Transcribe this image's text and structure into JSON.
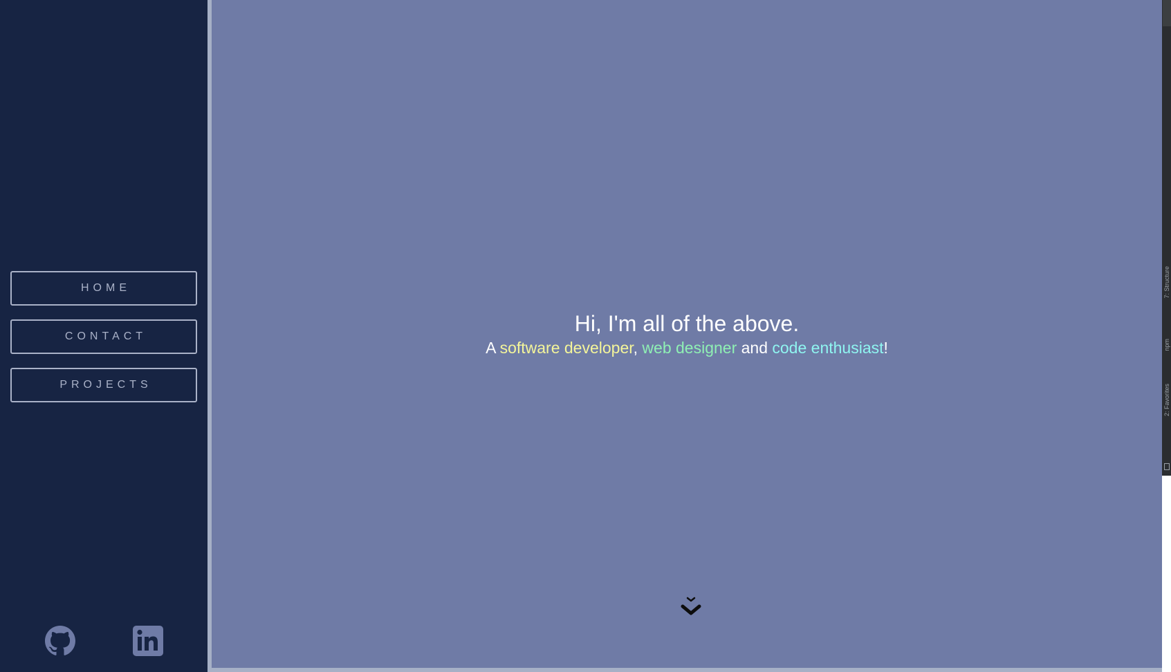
{
  "sidebar": {
    "nav": [
      {
        "label": "HOME"
      },
      {
        "label": "CONTACT"
      },
      {
        "label": "PROJECTS"
      }
    ],
    "social": [
      "github-icon",
      "linkedin-icon"
    ],
    "background": "#172443",
    "button_color": "#aab2c8"
  },
  "hero": {
    "title": "Hi, I'm all of the above.",
    "subtitle": {
      "prefix": "A ",
      "role1": "software developer",
      "sep1": ", ",
      "role2": "web designer",
      "sep2": " and ",
      "role3": "code enthusiast",
      "suffix": "!"
    },
    "colors": {
      "role1": "#f4f59a",
      "role2": "#8ff0b4",
      "role3": "#8ff5f0"
    }
  },
  "main": {
    "background": "#6f7ba6",
    "scroll_icon": "chevron-double-down-icon"
  },
  "ide_panel": {
    "tabs": [
      "7: Structure",
      "npm",
      "2: Favorites"
    ]
  }
}
